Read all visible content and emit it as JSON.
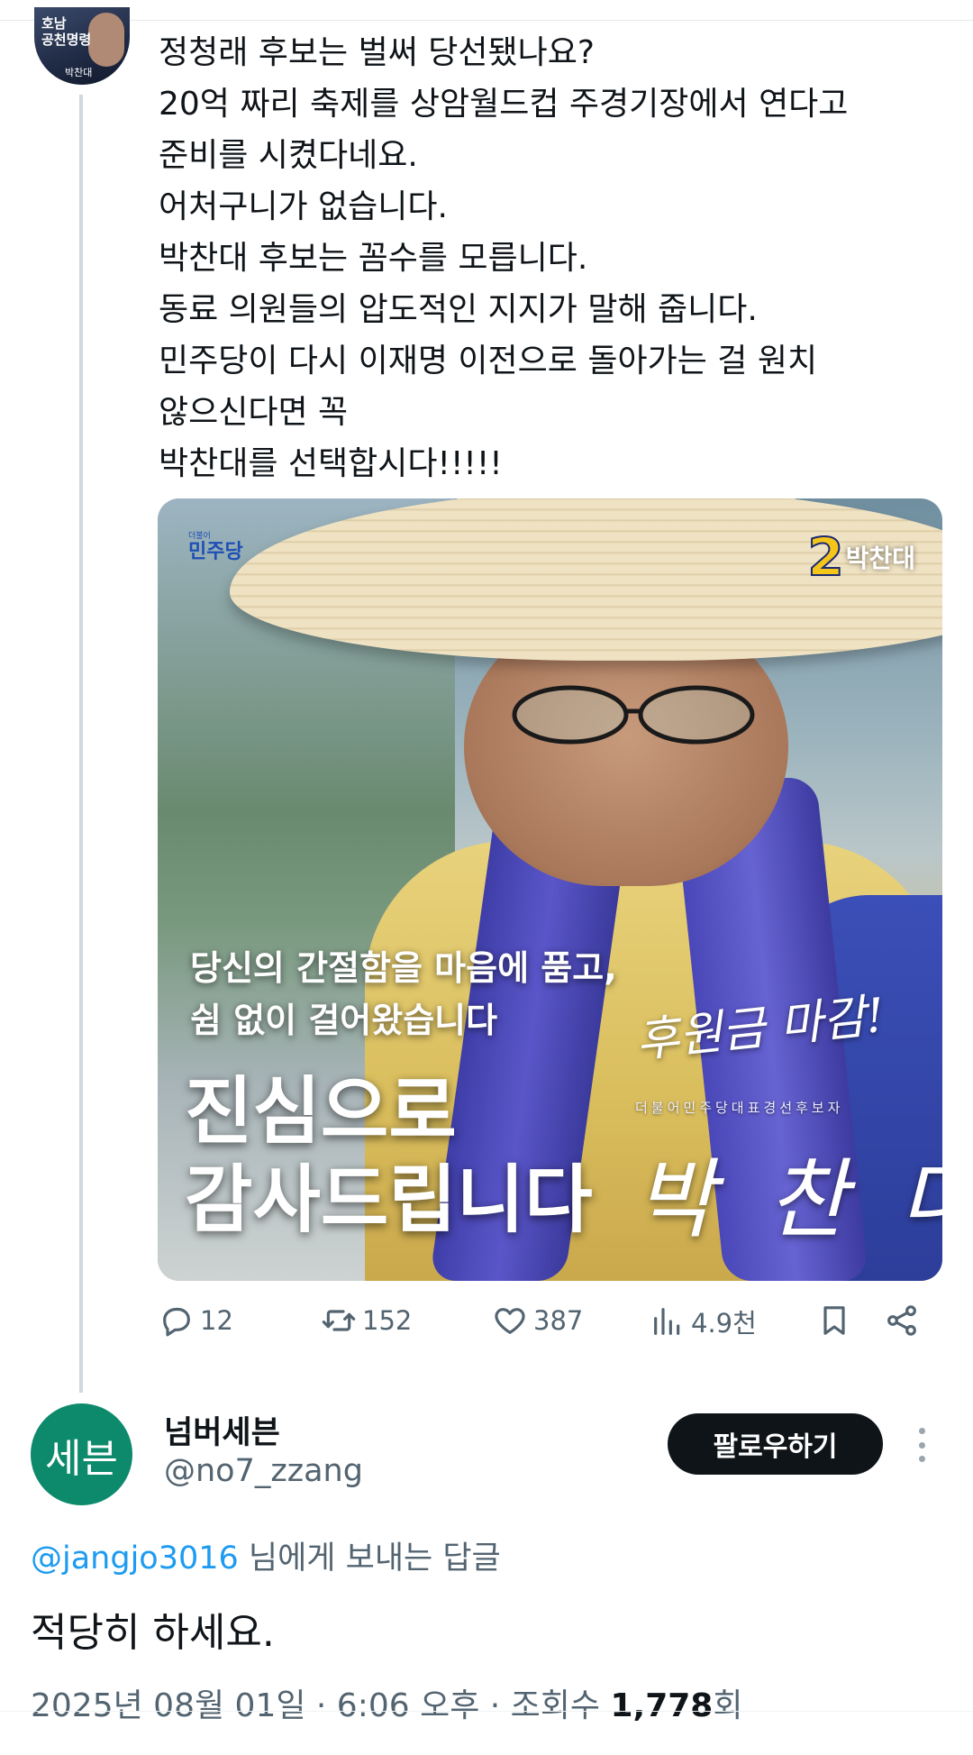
{
  "parent_tweet": {
    "avatar_text": [
      "호남",
      "공천명령"
    ],
    "avatar_tag": "박찬대",
    "lines": [
      "정청래 후보는 벌써 당선됐나요?",
      "20억 짜리 축제를 상암월드컵 주경기장에서 연다고",
      "준비를 시켰다네요.",
      "어처구니가 없습니다.",
      "박찬대 후보는 꼼수를 모릅니다.",
      "동료 의원들의 압도적인 지지가 말해 줍니다.",
      "민주당이 다시 이재명 이전으로 돌아가는 걸 원치",
      "않으신다면 꼭",
      "박찬대를 선택합시다!!!!!"
    ],
    "media": {
      "party_logo_small": "더불어",
      "party_logo": "민주당",
      "candidate_number": "2",
      "candidate_name": "박찬대",
      "sub_line_1": "당신의 간절함을 마음에 품고,",
      "sub_line_2": "쉼 없이 걸어왔습니다",
      "main_line_1": "진심으로",
      "main_line_2": "감사드립니다",
      "signature_top": "후원금 마감!",
      "signature_caption": "더불어민주당대표경선후보자",
      "signature_name": "박 찬 대"
    },
    "actions": {
      "replies": "12",
      "retweets": "152",
      "likes": "387",
      "views": "4.9천"
    }
  },
  "reply": {
    "avatar_text": "세븐",
    "display_name": "넘버세븐",
    "handle": "@no7_zzang",
    "follow_label": "팔로우하기",
    "reply_to_mention": "@jangjo3016",
    "reply_to_suffix": " 님에게 보내는 답글",
    "text": "적당히 하세요.",
    "date": "2025년 08월 01일 · 6:06 오후 · 조회수 ",
    "views_count": "1,778",
    "views_suffix": "회"
  },
  "colors": {
    "link": "#1d9bf0",
    "secondary_text": "#536471",
    "avatar_bg": "#0d8a6b",
    "follow_bg": "#0f1419"
  }
}
